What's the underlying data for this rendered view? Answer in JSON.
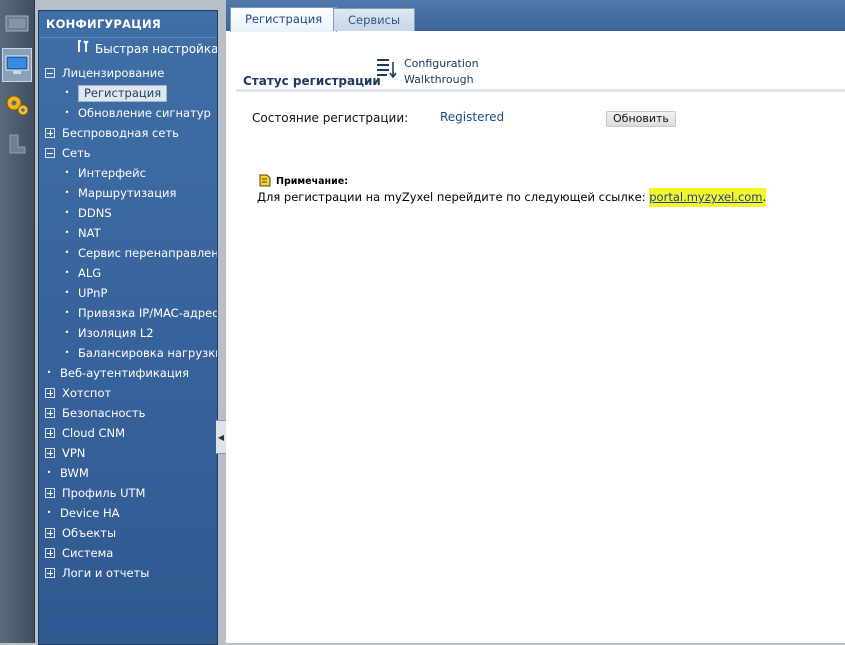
{
  "sidebar": {
    "title": "КОНФИГУРАЦИЯ",
    "quick_setup": "Быстрая настройка",
    "items": [
      {
        "label": "Лицензирование",
        "level": 0,
        "type": "minus"
      },
      {
        "label": "Регистрация",
        "level": 1,
        "type": "leaf",
        "selected": true
      },
      {
        "label": "Обновление сигнатур",
        "level": 1,
        "type": "leaf"
      },
      {
        "label": "Беспроводная сеть",
        "level": 0,
        "type": "plus"
      },
      {
        "label": "Сеть",
        "level": 0,
        "type": "minus"
      },
      {
        "label": "Интерфейс",
        "level": 1,
        "type": "leaf"
      },
      {
        "label": "Маршрутизация",
        "level": 1,
        "type": "leaf"
      },
      {
        "label": "DDNS",
        "level": 1,
        "type": "leaf"
      },
      {
        "label": "NAT",
        "level": 1,
        "type": "leaf"
      },
      {
        "label": "Сервис перенаправлени",
        "level": 1,
        "type": "leaf"
      },
      {
        "label": "ALG",
        "level": 1,
        "type": "leaf"
      },
      {
        "label": "UPnP",
        "level": 1,
        "type": "leaf"
      },
      {
        "label": "Привязка IP/MAC-адресо",
        "level": 1,
        "type": "leaf"
      },
      {
        "label": "Изоляция L2",
        "level": 1,
        "type": "leaf"
      },
      {
        "label": "Балансировка нагрузки с",
        "level": 1,
        "type": "leaf"
      },
      {
        "label": "Веб-аутентификация",
        "level": 0,
        "type": "leaf"
      },
      {
        "label": "Хотспот",
        "level": 0,
        "type": "plus"
      },
      {
        "label": "Безопасность",
        "level": 0,
        "type": "plus"
      },
      {
        "label": "Cloud CNM",
        "level": 0,
        "type": "plus"
      },
      {
        "label": "VPN",
        "level": 0,
        "type": "plus"
      },
      {
        "label": "BWM",
        "level": 0,
        "type": "leaf"
      },
      {
        "label": "Профиль UTM",
        "level": 0,
        "type": "plus"
      },
      {
        "label": "Device HA",
        "level": 0,
        "type": "leaf"
      },
      {
        "label": "Объекты",
        "level": 0,
        "type": "plus"
      },
      {
        "label": "Система",
        "level": 0,
        "type": "plus"
      },
      {
        "label": "Логи и отчеты",
        "level": 0,
        "type": "plus"
      }
    ]
  },
  "tabs": {
    "registration": "Регистрация",
    "services": "Сервисы"
  },
  "content": {
    "section_title": "Статус регистрации",
    "walkthrough_line1": "Configuration",
    "walkthrough_line2": "Walkthrough",
    "reg_state_label": "Состояние регистрации:",
    "reg_state_value": "Registered",
    "refresh_button": "Обновить",
    "note_title": "Примечание:",
    "note_text": "Для регистрации на myZyxel перейдите по следующей ссылке: ",
    "note_link": "portal.myzyxel.com",
    "note_suffix": "."
  },
  "colors": {
    "sidebar_bg": "#36619a",
    "highlight": "#f4f82a",
    "accent_text": "#1e4a7e"
  }
}
